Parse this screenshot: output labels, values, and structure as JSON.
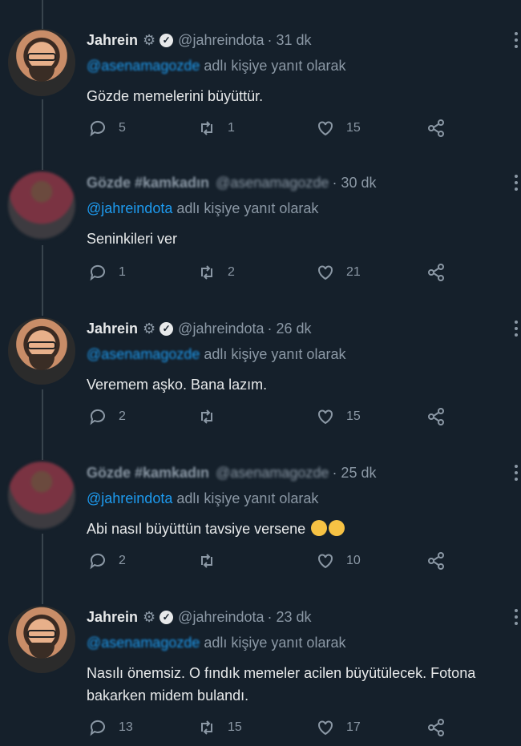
{
  "tweets": [
    {
      "author": "Jahrein",
      "handle": "@jahreindota",
      "time": "· 31 dk",
      "reply_mention": "@asenamagozde",
      "reply_suffix": " adlı kişiye yanıt olarak",
      "text": "Gözde memelerini büyüttür.",
      "replies": "5",
      "retweets": "1",
      "likes": "15"
    },
    {
      "author": "Gözde #kamkadın",
      "handle": "@asenamagozde",
      "time": "· 30 dk",
      "reply_mention": "@jahreindota",
      "reply_suffix": " adlı kişiye yanıt olarak",
      "text": "Seninkileri ver",
      "replies": "1",
      "retweets": "2",
      "likes": "21"
    },
    {
      "author": "Jahrein",
      "handle": "@jahreindota",
      "time": "· 26 dk",
      "reply_mention": "@asenamagozde",
      "reply_suffix": " adlı kişiye yanıt olarak",
      "text": "Veremem aşko. Bana lazım.",
      "replies": "2",
      "retweets": "",
      "likes": "15"
    },
    {
      "author": "Gözde #kamkadın",
      "handle": "@asenamagozde",
      "time": "· 25 dk",
      "reply_mention": "@jahreindota",
      "reply_suffix": " adlı kişiye yanıt olarak",
      "text": "Abi nasıl büyüttün tavsiye versene",
      "replies": "2",
      "retweets": "",
      "likes": "10"
    },
    {
      "author": "Jahrein",
      "handle": "@jahreindota",
      "time": "· 23 dk",
      "reply_mention": "@asenamagozde",
      "reply_suffix": " adlı kişiye yanıt olarak",
      "text": "Nasılı önemsiz. O fındık memeler acilen büyütülecek. Fotona bakarken midem bulandı.",
      "replies": "13",
      "retweets": "15",
      "likes": "17"
    }
  ],
  "colors": {
    "background": "#15202b",
    "link": "#1d9bf0",
    "muted": "#8b98a5",
    "text": "#e7e9ea"
  },
  "icons": [
    "reply-icon",
    "retweet-icon",
    "like-icon",
    "share-icon",
    "more-icon",
    "settings-icon",
    "verified-icon"
  ]
}
